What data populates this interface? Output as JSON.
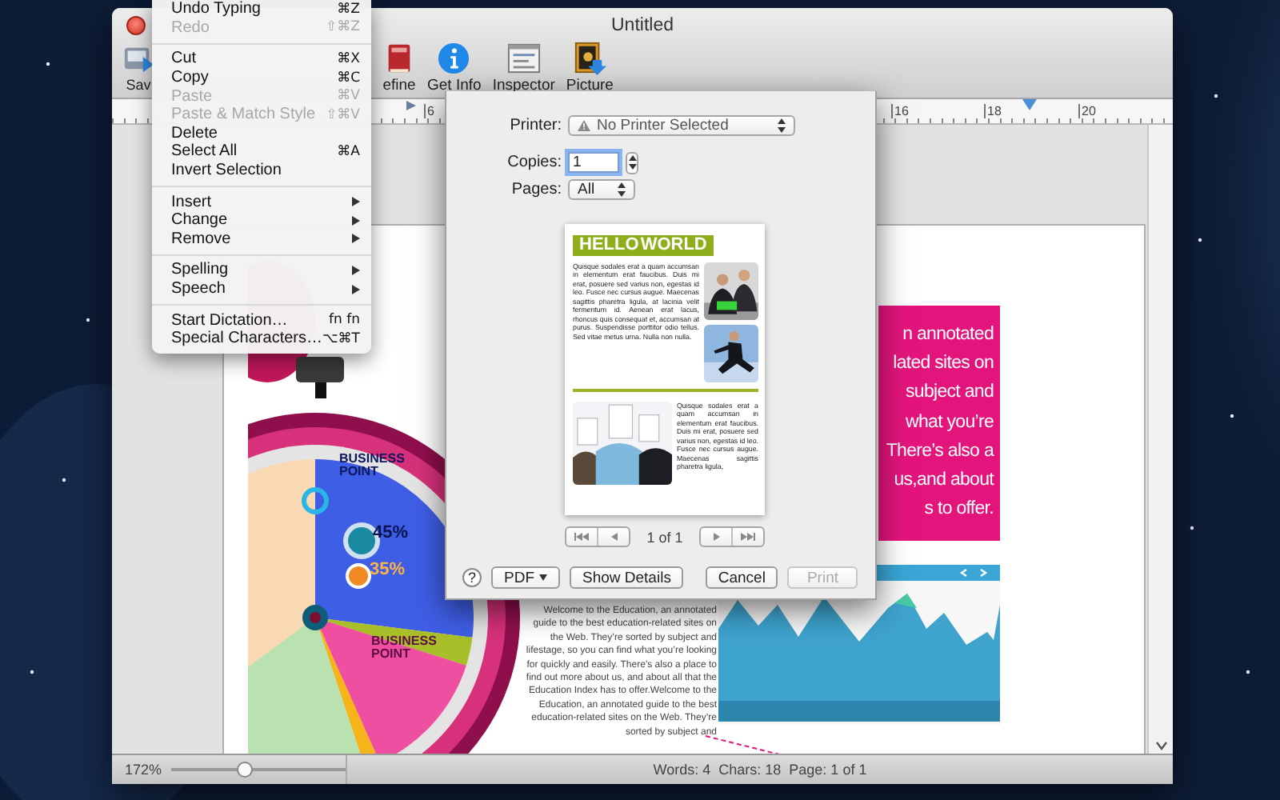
{
  "window": {
    "title": "Untitled"
  },
  "toolbar": [
    {
      "label": "Sav",
      "kind": "save"
    },
    {
      "label": "efine",
      "kind": "define"
    },
    {
      "label": "Get Info",
      "kind": "info"
    },
    {
      "label": "Inspector",
      "kind": "inspector"
    },
    {
      "label": "Picture",
      "kind": "picture"
    }
  ],
  "ruler": {
    "labels": [
      "6",
      "16",
      "18",
      "20"
    ]
  },
  "document": {
    "infographic": {
      "headings": [
        "BUSINESS POINT",
        "BUSINESS POINT"
      ],
      "stats": [
        "45%",
        "35%"
      ]
    },
    "callout_text": "n annotated\nlated sites on\nsubject and\nwhat you’re\nThere’s also a\nus,and about\ns to offer.",
    "body_text": "Welcome to the Education, an annotated guide to the best education-related sites on the Web. They’re sorted by subject and lifestage, so you can find what you’re looking for quickly and easily. There’s also a place to find out more about us, and about all that the Education Index has to offer.Welcome to the Education, an annotated guide to the best education-related sites on the Web. They’re sorted by subject and"
  },
  "status_bar": {
    "zoom": "172%",
    "zoom_slider": {
      "level": 0.42
    },
    "stats": "Words: 4  Chars: 18  Page: 1 of 1"
  },
  "print_dialog": {
    "printer": {
      "label": "Printer:",
      "value": "No Printer Selected"
    },
    "copies": {
      "label": "Copies:",
      "value": "1"
    },
    "pages": {
      "label": "Pages:",
      "value": "All"
    },
    "preview": {
      "heading": "HELLO WORLD",
      "paragraphs": [
        "Quisque sodales erat a quam accumsan in elementum erat faucibus. Duis mi erat, posuere sed varius non, egestas id leo. Fusce nec cursus augue. Maecenas sagittis pharetra ligula, at lacinia velit fermentum id. Aenean erat lacus, rhoncus quis consequat et, accumsan at purus. Suspendisse porttitor odio tellus. Sed vitae metus urna. Nulla non nulla.",
        "Quisque sodales erat a quam accumsan in elementum erat faucibus. Duis mi erat, posuere sed varius non, egestas id leo. Fusce nec cursus augue. Maecenas sagittis pharetra ligula,"
      ]
    },
    "page_indicator": "1 of 1",
    "help": "?",
    "buttons": [
      {
        "label": "PDF",
        "kind": "menu",
        "disabled": false
      },
      {
        "label": "Show Details",
        "kind": "push",
        "disabled": false
      },
      {
        "label": "Cancel",
        "kind": "push",
        "disabled": false
      },
      {
        "label": "Print",
        "kind": "push",
        "disabled": true
      }
    ]
  },
  "edit_menu": {
    "groups": [
      {
        "items": [
          {
            "label": "Undo Typing",
            "shortcut": "⌘Z",
            "disabled": false,
            "submenu": false
          },
          {
            "label": "Redo",
            "shortcut": "⇧⌘Z",
            "disabled": true,
            "submenu": false
          }
        ]
      },
      {
        "items": [
          {
            "label": "Cut",
            "shortcut": "⌘X",
            "disabled": false,
            "submenu": false
          },
          {
            "label": "Copy",
            "shortcut": "⌘C",
            "disabled": false,
            "submenu": false
          },
          {
            "label": "Paste",
            "shortcut": "⌘V",
            "disabled": true,
            "submenu": false
          },
          {
            "label": "Paste & Match Style",
            "shortcut": "⇧⌘V",
            "disabled": true,
            "submenu": false
          },
          {
            "label": "Delete",
            "disabled": false,
            "submenu": false
          },
          {
            "label": "Select All",
            "shortcut": "⌘A",
            "disabled": false,
            "submenu": false
          },
          {
            "label": "Invert Selection",
            "disabled": false,
            "submenu": false
          }
        ]
      },
      {
        "items": [
          {
            "label": "Insert",
            "disabled": false,
            "submenu": true
          },
          {
            "label": "Change",
            "disabled": false,
            "submenu": true
          },
          {
            "label": "Remove",
            "disabled": false,
            "submenu": true
          }
        ]
      },
      {
        "items": [
          {
            "label": "Spelling",
            "disabled": false,
            "submenu": true
          },
          {
            "label": "Speech",
            "disabled": false,
            "submenu": true
          }
        ]
      },
      {
        "items": [
          {
            "label": "Start Dictation…",
            "shortcut": "fn fn",
            "disabled": false,
            "submenu": false
          },
          {
            "label": "Special Characters…",
            "shortcut": "⌥⌘T",
            "disabled": false,
            "submenu": false
          }
        ]
      }
    ]
  }
}
